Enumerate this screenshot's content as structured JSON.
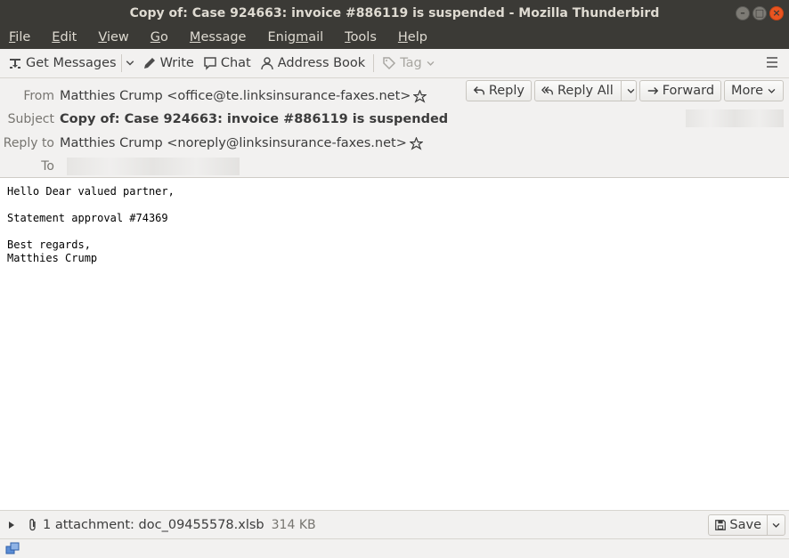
{
  "window": {
    "title": "Copy of: Case 924663: invoice #886119 is suspended - Mozilla Thunderbird"
  },
  "menu": [
    {
      "pre": "",
      "u": "F",
      "post": "ile"
    },
    {
      "pre": "",
      "u": "E",
      "post": "dit"
    },
    {
      "pre": "",
      "u": "V",
      "post": "iew"
    },
    {
      "pre": "",
      "u": "G",
      "post": "o"
    },
    {
      "pre": "",
      "u": "M",
      "post": "essage"
    },
    {
      "pre": "Enig",
      "u": "m",
      "post": "ail"
    },
    {
      "pre": "",
      "u": "T",
      "post": "ools"
    },
    {
      "pre": "",
      "u": "H",
      "post": "elp"
    }
  ],
  "toolbar": {
    "get_messages": "Get Messages",
    "write": "Write",
    "chat": "Chat",
    "address_book": "Address Book",
    "tag": "Tag"
  },
  "header": {
    "from_label": "From",
    "from_value": "Matthies Crump <office@te.linksinsurance-faxes.net>",
    "subject_label": "Subject",
    "subject_value": "Copy of: Case 924663: invoice #886119 is suspended",
    "replyto_label": "Reply to",
    "replyto_value": "Matthies Crump <noreply@linksinsurance-faxes.net>",
    "to_label": "To",
    "buttons": {
      "reply": "Reply",
      "reply_all": "Reply All",
      "forward": "Forward",
      "more": "More"
    }
  },
  "body": {
    "lines": [
      "Hello Dear valued partner,",
      "",
      "Statement approval #74369",
      "",
      "Best regards,",
      "Matthies Crump"
    ]
  },
  "attachment": {
    "summary": "1 attachment: doc_09455578.xlsb",
    "size": "314 KB",
    "save": "Save"
  }
}
